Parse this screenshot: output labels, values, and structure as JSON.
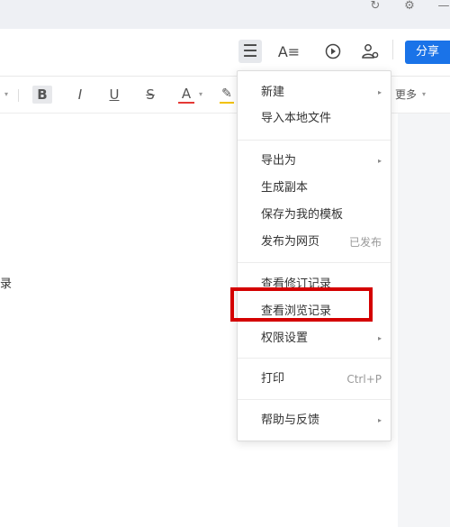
{
  "titlebar": {
    "icons": [
      "sync-icon",
      "settings-icon",
      "minimize-icon"
    ]
  },
  "header": {
    "icons": [
      "menu-icon",
      "text-style-icon",
      "play-icon",
      "collaborator-icon"
    ],
    "share_label": "分享"
  },
  "toolbar": {
    "bold": "B",
    "italic": "I",
    "underline": "U",
    "strike": "S",
    "font_color": "A",
    "more_label": "更多"
  },
  "document": {
    "visible_text": "录"
  },
  "menu": {
    "items": [
      {
        "label": "新建",
        "submenu": true
      },
      {
        "label": "导入本地文件"
      },
      {
        "label": "导出为",
        "submenu": true
      },
      {
        "label": "生成副本"
      },
      {
        "label": "保存为我的模板"
      },
      {
        "label": "发布为网页",
        "hint": "已发布"
      },
      {
        "label": "查看修订记录"
      },
      {
        "label": "查看浏览记录",
        "highlighted": true
      },
      {
        "label": "权限设置",
        "submenu": true
      },
      {
        "label": "打印",
        "hint": "Ctrl+P"
      },
      {
        "label": "帮助与反馈",
        "submenu": true
      }
    ]
  },
  "colors": {
    "accent": "#1a73e8",
    "highlight_border": "#d40000",
    "font_color_underline": "#e53935",
    "highlighter": "#f2c200"
  }
}
